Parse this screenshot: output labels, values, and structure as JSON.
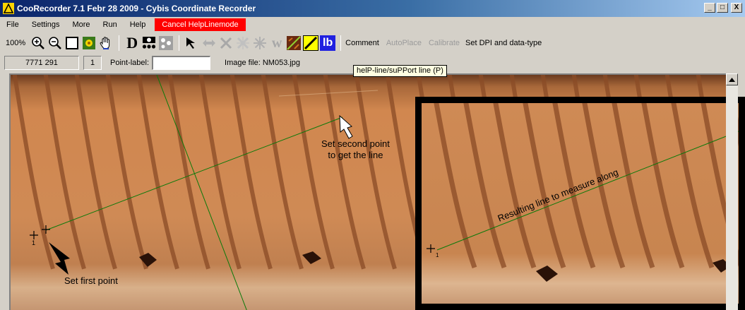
{
  "window": {
    "title": "CooRecorder 7.1 Febr 28 2009 - Cybis Coordinate Recorder",
    "controls": [
      "_",
      "□",
      "X"
    ]
  },
  "menu": {
    "items": [
      "File",
      "Settings",
      "More",
      "Run",
      "Help"
    ],
    "cancel_label": "Cancel HelpLinemode"
  },
  "toolbar": {
    "zoom": "100%",
    "comment": "Comment",
    "autoplace": "AutoPlace",
    "calibrate": "Calibrate",
    "dpi": "Set DPI and data-type",
    "letter_d": "D",
    "letter_w": "w",
    "letter_lb": "lb",
    "tooltip": "helP-line/suPPort line (P)"
  },
  "info": {
    "coords": "7771  291",
    "count": "1",
    "point_label_caption": "Point-label:",
    "point_label_value": "",
    "image_file": "Image file: NM053.jpg"
  },
  "annotations": {
    "second_point_line1": "Set second point",
    "second_point_line2": "to get the line",
    "first_point": "Set first point",
    "result_line": "Resulting line to measure along",
    "point_index": "1"
  },
  "colors": {
    "cancel_bg": "#ff0000",
    "help_line": "#007a00",
    "wood": "#c97a45",
    "titlebar": "#0a246a"
  }
}
